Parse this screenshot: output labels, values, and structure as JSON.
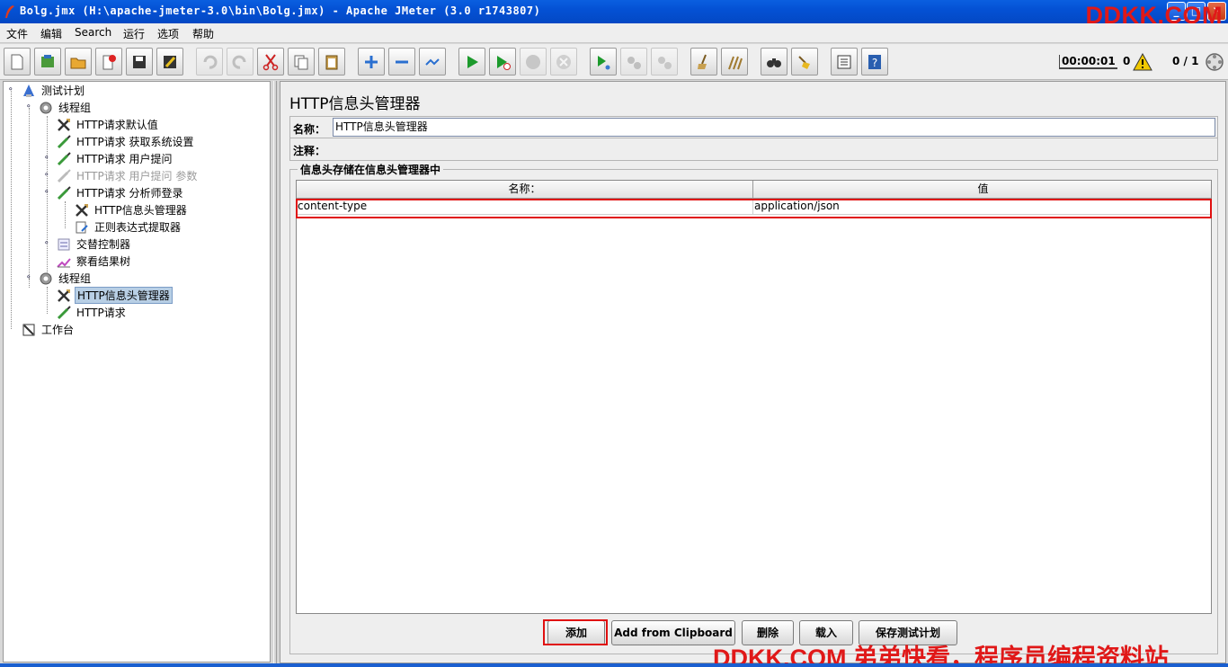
{
  "window": {
    "title": "Bolg.jmx (H:\\apache-jmeter-3.0\\bin\\Bolg.jmx) - Apache JMeter (3.0 r1743807)",
    "watermark_top": "DDKK.COM",
    "watermark_bottom": "DDKK.COM 弟弟快看，程序员编程资料站"
  },
  "menu": [
    "文件",
    "编辑",
    "Search",
    "运行",
    "选项",
    "帮助"
  ],
  "toolbar": {
    "buttons": [
      "new",
      "templates",
      "open",
      "close",
      "save",
      "save-as",
      "undo",
      "redo",
      "cut",
      "copy",
      "paste",
      "expand",
      "collapse",
      "toggle",
      "start",
      "start-no-pause",
      "stop",
      "shutdown",
      "remote-start",
      "remote-stop",
      "remote-shutdown",
      "clear",
      "clear-all",
      "search",
      "reset-search",
      "function-helper",
      "help"
    ],
    "timer": "00:00:01",
    "error_count": "0",
    "threads": "0 / 1"
  },
  "tree": {
    "nodes": [
      {
        "label": "测试计划",
        "level": 0,
        "icon": "test-plan-icon"
      },
      {
        "label": "线程组",
        "level": 1,
        "icon": "thread-group-icon"
      },
      {
        "label": "HTTP请求默认值",
        "level": 2,
        "icon": "config-icon"
      },
      {
        "label": "HTTP请求 获取系统设置",
        "level": 2,
        "icon": "sampler-icon"
      },
      {
        "label": "HTTP请求 用户提问",
        "level": 2,
        "icon": "sampler-icon"
      },
      {
        "label": "HTTP请求 用户提问 参数",
        "level": 2,
        "icon": "sampler-icon",
        "disabled": true
      },
      {
        "label": "HTTP请求 分析师登录",
        "level": 2,
        "icon": "sampler-icon"
      },
      {
        "label": "HTTP信息头管理器",
        "level": 3,
        "icon": "config-icon"
      },
      {
        "label": "正则表达式提取器",
        "level": 3,
        "icon": "extractor-icon"
      },
      {
        "label": "交替控制器",
        "level": 2,
        "icon": "controller-icon"
      },
      {
        "label": "察看结果树",
        "level": 2,
        "icon": "listener-icon"
      },
      {
        "label": "线程组",
        "level": 1,
        "icon": "thread-group-icon"
      },
      {
        "label": "HTTP信息头管理器",
        "level": 2,
        "icon": "config-icon",
        "selected": true
      },
      {
        "label": "HTTP请求",
        "level": 2,
        "icon": "sampler-icon"
      },
      {
        "label": "工作台",
        "level": 0,
        "icon": "workbench-icon"
      }
    ]
  },
  "panel": {
    "title": "HTTP信息头管理器",
    "name_label": "名称：",
    "name_value": "HTTP信息头管理器",
    "comment_label": "注释：",
    "comment_value": "",
    "section_title": "信息头存储在信息头管理器中",
    "table": {
      "columns": [
        "名称：",
        "值"
      ],
      "rows": [
        [
          "content-type",
          "application/json"
        ]
      ]
    },
    "buttons": {
      "add": "添加",
      "add_clipboard": "Add from Clipboard",
      "delete": "删除",
      "load": "载入",
      "save": "保存测试计划"
    }
  },
  "colors": {
    "titlebar": "#0451d4",
    "highlight": "#e01010",
    "selection": "#b8cfe5"
  }
}
